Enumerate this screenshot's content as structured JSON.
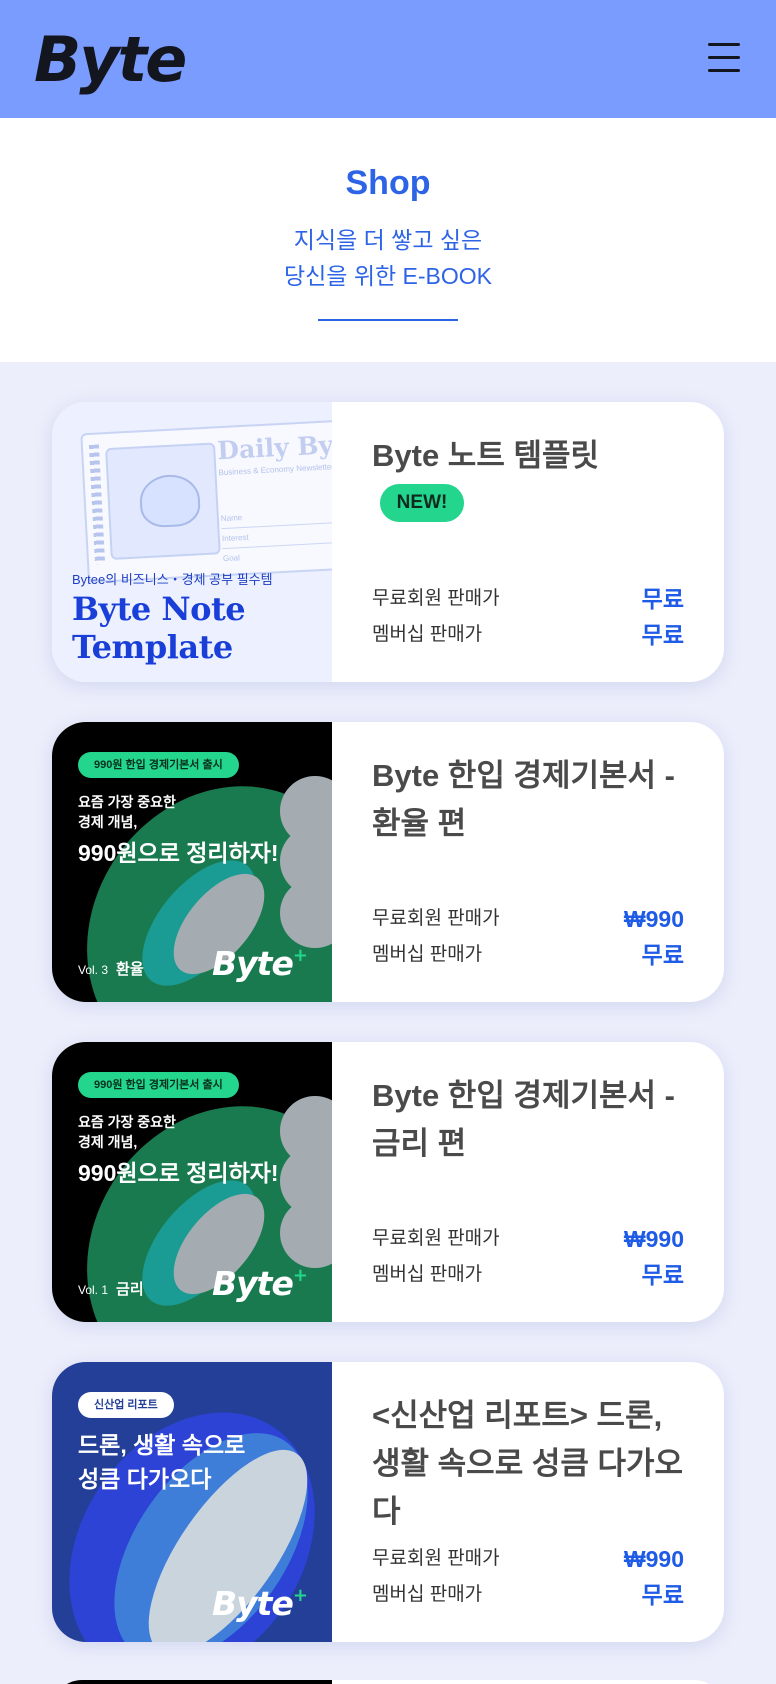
{
  "header": {
    "logo": "Byte",
    "menu_icon": "hamburger-menu-icon"
  },
  "hero": {
    "title": "Shop",
    "subtitle_line1": "지식을 더 쌓고 싶은",
    "subtitle_line2": "당신을 위한 E-BOOK"
  },
  "colors": {
    "header_bg": "#7a9cff",
    "accent": "#2d64e6",
    "price": "#1e5be6",
    "new_badge": "#23d58d",
    "page_bg": "#eceefb"
  },
  "products": [
    {
      "title": "Byte 노트 템플릿",
      "badge": "NEW!",
      "price_free_label": "무료회원 판매가",
      "price_free": "무료",
      "price_member_label": "멤버십 판매가",
      "price_member": "무료",
      "thumb": {
        "cert_title": "Daily Byte",
        "cert_sub": "Business & Economy Newsletter",
        "cert_name": "Name",
        "cert_interest": "Interest",
        "cert_goal": "Goal",
        "tag": "Bytee의 비즈니스・경제 공부 필수템",
        "big": "Byte Note\nTemplate"
      }
    },
    {
      "title": "Byte 한입 경제기본서 - 환율 편",
      "price_free_label": "무료회원 판매가",
      "price_free": "₩990",
      "price_member_label": "멤버십 판매가",
      "price_member": "무료",
      "thumb": {
        "pill": "990원 한입 경제기본서 출시",
        "small": "요즘 가장 중요한\n경제 개념,",
        "big": "990원으로 정리하자!",
        "vol": "Vol. 3",
        "topic": "환율",
        "logo": "Byte",
        "plus": "+"
      }
    },
    {
      "title": "Byte 한입 경제기본서 - 금리 편",
      "price_free_label": "무료회원 판매가",
      "price_free": "₩990",
      "price_member_label": "멤버십 판매가",
      "price_member": "무료",
      "thumb": {
        "pill": "990원 한입 경제기본서 출시",
        "small": "요즘 가장 중요한\n경제 개념,",
        "big": "990원으로 정리하자!",
        "vol": "Vol. 1",
        "topic": "금리",
        "logo": "Byte",
        "plus": "+"
      }
    },
    {
      "title": "<신산업 리포트> 드론, 생활 속으로 성큼 다가오다",
      "price_free_label": "무료회원 판매가",
      "price_free": "₩990",
      "price_member_label": "멤버십 판매가",
      "price_member": "무료",
      "thumb": {
        "pill": "신산업 리포트",
        "head": "드론, 생활 속으로\n성큼 다가오다",
        "logo": "Byte",
        "plus": "+"
      }
    }
  ]
}
